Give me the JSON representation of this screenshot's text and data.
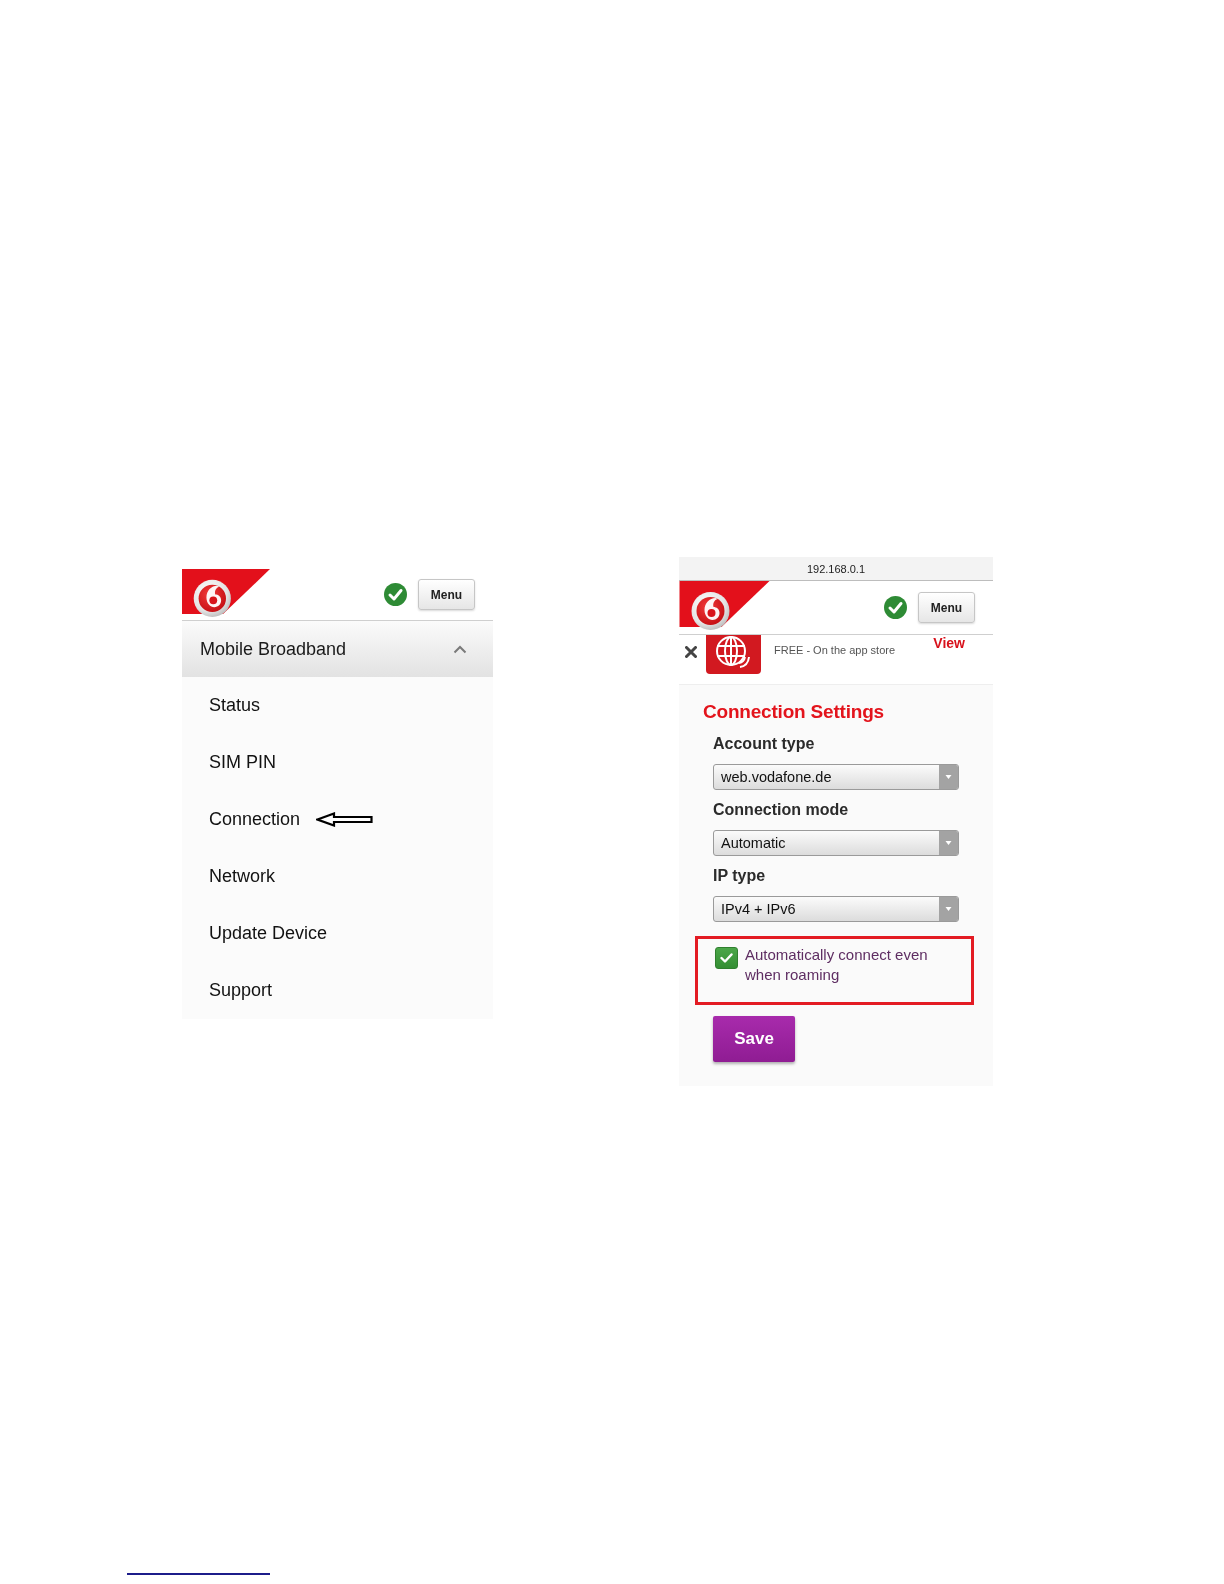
{
  "left_screen": {
    "header": {
      "menu_button": "Menu"
    },
    "section": {
      "title": "Mobile Broadband",
      "expanded": true
    },
    "items": [
      {
        "label": "Status",
        "annotated": false
      },
      {
        "label": "SIM PIN",
        "annotated": false
      },
      {
        "label": "Connection",
        "annotated": true
      },
      {
        "label": "Network",
        "annotated": false
      },
      {
        "label": "Update Device",
        "annotated": false
      },
      {
        "label": "Support",
        "annotated": false
      }
    ]
  },
  "right_screen": {
    "address_bar": "192.168.0.1",
    "header": {
      "menu_button": "Menu"
    },
    "app_banner": {
      "subtitle": "FREE - On the app store",
      "action": "View"
    },
    "title": "Connection Settings",
    "fields": [
      {
        "label": "Account type",
        "value": "web.vodafone.de"
      },
      {
        "label": "Connection mode",
        "value": "Automatic"
      },
      {
        "label": "IP type",
        "value": "IPv4 + IPv6"
      }
    ],
    "roaming_option": {
      "label": "Automatically connect even when roaming",
      "checked": true,
      "highlighted": true
    },
    "save_button": "Save"
  }
}
